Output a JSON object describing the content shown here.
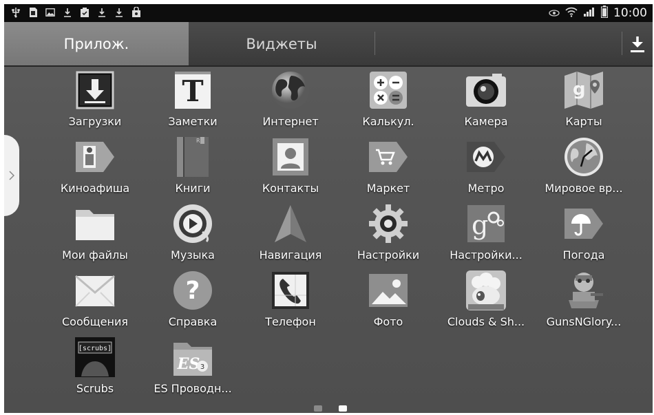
{
  "tabs": {
    "apps_label": "Прилож.",
    "widgets_label": "Виджеты"
  },
  "status_bar": {
    "time": "10:00",
    "left_icons": [
      "usb-icon",
      "sd-card-icon",
      "image-icon",
      "download-icon",
      "clipboard-check-icon",
      "download-icon",
      "download-icon",
      "shopping-bag-icon"
    ],
    "right_icons": [
      "eye-icon",
      "wifi-icon",
      "signal-icon",
      "battery-icon"
    ]
  },
  "apps": [
    {
      "label": "Загрузки",
      "icon": "downloads-icon"
    },
    {
      "label": "Заметки",
      "icon": "notes-icon"
    },
    {
      "label": "Интернет",
      "icon": "globe-icon"
    },
    {
      "label": "Калькул.",
      "icon": "calculator-icon"
    },
    {
      "label": "Камера",
      "icon": "camera-icon"
    },
    {
      "label": "Карты",
      "icon": "maps-icon"
    },
    {
      "label": "Киноафиша",
      "icon": "cinema-icon"
    },
    {
      "label": "Книги",
      "icon": "books-icon"
    },
    {
      "label": "Контакты",
      "icon": "contacts-icon"
    },
    {
      "label": "Маркет",
      "icon": "market-icon"
    },
    {
      "label": "Метро",
      "icon": "metro-icon"
    },
    {
      "label": "Мировое вр...",
      "icon": "world-clock-icon"
    },
    {
      "label": "Мои файлы",
      "icon": "folder-icon"
    },
    {
      "label": "Музыка",
      "icon": "music-icon"
    },
    {
      "label": "Навигация",
      "icon": "navigation-icon"
    },
    {
      "label": "Настройки",
      "icon": "settings-icon"
    },
    {
      "label": "Настройки...",
      "icon": "google-settings-icon"
    },
    {
      "label": "Погода",
      "icon": "weather-icon"
    },
    {
      "label": "Сообщения",
      "icon": "messages-icon"
    },
    {
      "label": "Справка",
      "icon": "help-icon"
    },
    {
      "label": "Телефон",
      "icon": "phone-icon"
    },
    {
      "label": "Фото",
      "icon": "photos-icon"
    },
    {
      "label": "Clouds & Sh...",
      "icon": "clouds-sheep-icon"
    },
    {
      "label": "GunsNGlory...",
      "icon": "gunsnglory-icon"
    },
    {
      "label": "Scrubs",
      "icon": "scrubs-icon"
    },
    {
      "label": "ES Проводн...",
      "icon": "es-explorer-icon"
    }
  ],
  "pages": {
    "total": 2,
    "current": 2
  },
  "colors": {
    "tab_active": "#888888",
    "status_bar": "#0d0d0d",
    "background": "#555555"
  }
}
